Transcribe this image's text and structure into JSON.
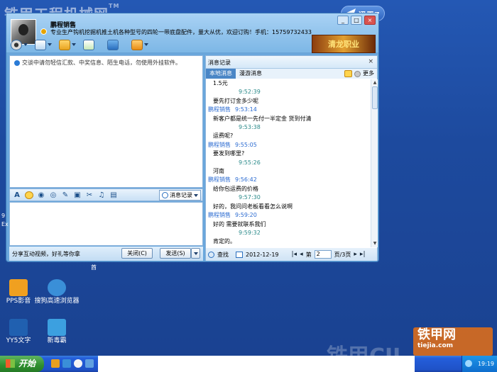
{
  "watermark": {
    "top": "铁甲工程机械网",
    "tm": "TM",
    "bottom_left": "铁甲CII",
    "bottom_right_brand": "铁甲网",
    "bottom_right_url": "tiejia.com"
  },
  "xunlei": {
    "label": "迅雷7"
  },
  "chat_window": {
    "contact_name": "鹏程销售",
    "signature": "专业生产钩机挖掘机推土机各种型号的四轮一带底盘配件，量大从优，欢迎订购！手机：15759732433",
    "ad_banner": "清龙职业",
    "notice": "交谈中请勿轻信汇款、中奖信息、陌生电话，勿使用外挂软件。",
    "history_button": "消息记录",
    "promo_text": "分享互动视频，好礼等你拿",
    "close_button": "关闭(C)",
    "send_button": "发送(S)"
  },
  "history": {
    "title": "消息记录",
    "close_glyph": "×",
    "tabs": [
      "本地消息",
      "漫游消息"
    ],
    "more_label": "更多",
    "messages": [
      {
        "type": "body",
        "text": "1.5元"
      },
      {
        "type": "time",
        "text": "9:52:39"
      },
      {
        "type": "body",
        "text": "要先打订金多少呢"
      },
      {
        "type": "sender",
        "name": "鹏程销售",
        "time": "9:53:14"
      },
      {
        "type": "body",
        "text": "新客户都是统一先付一半定金  货到付清"
      },
      {
        "type": "time",
        "text": "9:53:38"
      },
      {
        "type": "body",
        "text": "运费呢?"
      },
      {
        "type": "sender",
        "name": "鹏程销售",
        "time": "9:55:05"
      },
      {
        "type": "body",
        "text": "要发到哪里?"
      },
      {
        "type": "time",
        "text": "9:55:26"
      },
      {
        "type": "body",
        "text": "河南"
      },
      {
        "type": "sender",
        "name": "鹏程销售",
        "time": "9:56:42"
      },
      {
        "type": "body",
        "text": "给你包运费的价格"
      },
      {
        "type": "time",
        "text": "9:57:30"
      },
      {
        "type": "body",
        "text": "好的，我问问老板看看怎么说啊"
      },
      {
        "type": "sender",
        "name": "鹏程销售",
        "time": "9:59:20"
      },
      {
        "type": "body",
        "text": "好的  需要就联系我们"
      },
      {
        "type": "time",
        "text": "9:59:32"
      },
      {
        "type": "body",
        "text": "肯定的。"
      },
      {
        "type": "time",
        "text": "10:01:41"
      }
    ],
    "footer": {
      "search_label": "查找",
      "date": "2012-12-19",
      "page_prefix": "第",
      "page_value": "2",
      "page_suffix": "页/3页"
    }
  },
  "desktop_icons": [
    {
      "label": "PPS影音",
      "color": "#f0a020"
    },
    {
      "label": "搜狗高速浏览器",
      "color": "#3a8fd8"
    },
    {
      "label": "YY5文字",
      "color": "#2060b0"
    },
    {
      "label": "新毒霸",
      "color": "#3ca0e0"
    }
  ],
  "side_labels": {
    "left_top": "9",
    "left_mid": "Ex",
    "left_bottom": "9\nE",
    "under_window": "酋"
  },
  "taskbar": {
    "start_label": "开始",
    "clock": "19:19"
  }
}
